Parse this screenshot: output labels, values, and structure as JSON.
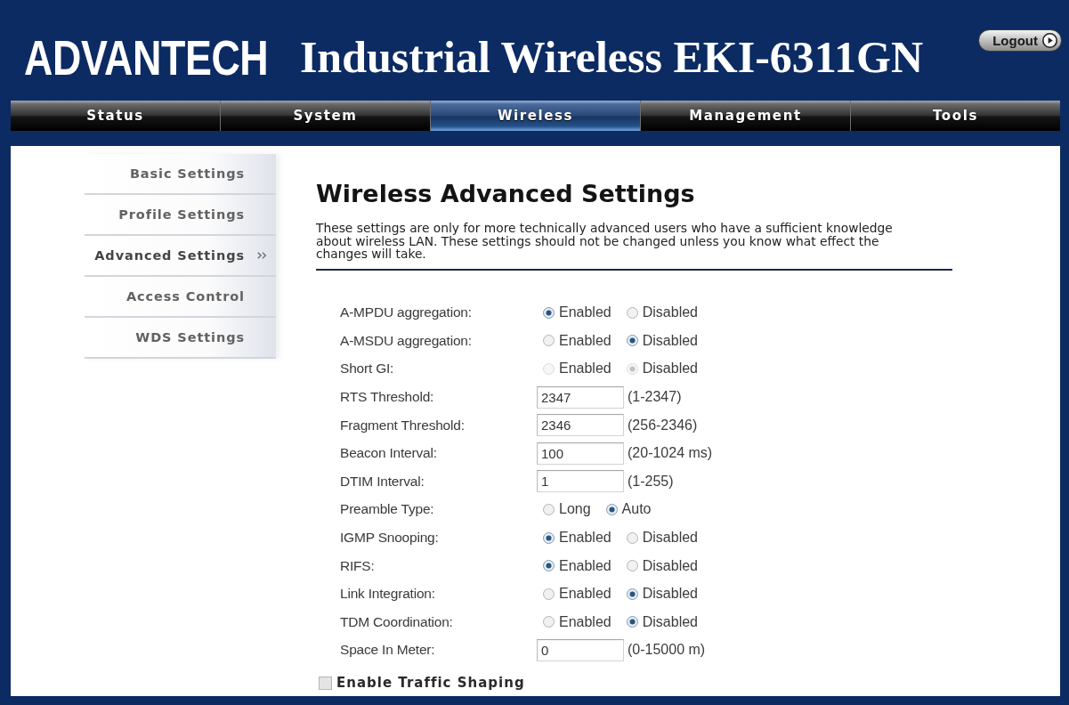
{
  "header": {
    "logo": "ADVANTECH",
    "title": "Industrial Wireless EKI-6311GN",
    "logout_button": "Logout"
  },
  "nav_tabs": [
    {
      "label": "Status",
      "selected": false
    },
    {
      "label": "System",
      "selected": false
    },
    {
      "label": "Wireless",
      "selected": true
    },
    {
      "label": "Management",
      "selected": false
    },
    {
      "label": "Tools",
      "selected": false
    }
  ],
  "sidebar": {
    "items": [
      {
        "label": "Basic Settings",
        "selected": false
      },
      {
        "label": "Profile Settings",
        "selected": false
      },
      {
        "label": "Advanced Settings",
        "selected": true
      },
      {
        "label": "Access Control",
        "selected": false
      },
      {
        "label": "WDS Settings",
        "selected": false
      }
    ]
  },
  "main": {
    "title": "Wireless Advanced Settings",
    "description": "These settings are only for more technically advanced users who have a sufficient knowledge about wireless LAN. These settings should not be changed unless you know what effect the changes will take.",
    "settings": [
      {
        "kind": "radio",
        "label": "A-MPDU aggregation:",
        "disabled": false,
        "options": [
          {
            "label": "Enabled",
            "selected": true
          },
          {
            "label": "Disabled",
            "selected": false
          }
        ]
      },
      {
        "kind": "radio",
        "label": "A-MSDU aggregation:",
        "disabled": false,
        "options": [
          {
            "label": "Enabled",
            "selected": false
          },
          {
            "label": "Disabled",
            "selected": true
          }
        ]
      },
      {
        "kind": "radio",
        "label": "Short GI:",
        "disabled": true,
        "options": [
          {
            "label": "Enabled",
            "selected": false
          },
          {
            "label": "Disabled",
            "selected": true
          }
        ]
      },
      {
        "kind": "input",
        "label": "RTS Threshold:",
        "disabled": false,
        "value": "2347",
        "range": "(1-2347)"
      },
      {
        "kind": "input",
        "label": "Fragment Threshold:",
        "disabled": false,
        "value": "2346",
        "range": "(256-2346)"
      },
      {
        "kind": "input",
        "label": "Beacon Interval:",
        "disabled": false,
        "value": "100",
        "range": "(20-1024 ms)"
      },
      {
        "kind": "input",
        "label": "DTIM Interval:",
        "disabled": false,
        "value": "1",
        "range": "(1-255)"
      },
      {
        "kind": "radio",
        "label": "Preamble Type:",
        "disabled": false,
        "options": [
          {
            "label": "Long",
            "selected": false
          },
          {
            "label": "Auto",
            "selected": true
          }
        ]
      },
      {
        "kind": "radio",
        "label": "IGMP Snooping:",
        "disabled": false,
        "options": [
          {
            "label": "Enabled",
            "selected": true
          },
          {
            "label": "Disabled",
            "selected": false
          }
        ]
      },
      {
        "kind": "radio",
        "label": "RIFS:",
        "disabled": false,
        "options": [
          {
            "label": "Enabled",
            "selected": true
          },
          {
            "label": "Disabled",
            "selected": false
          }
        ]
      },
      {
        "kind": "radio",
        "label": "Link Integration:",
        "disabled": false,
        "options": [
          {
            "label": "Enabled",
            "selected": false
          },
          {
            "label": "Disabled",
            "selected": true
          }
        ]
      },
      {
        "kind": "radio",
        "label": "TDM Coordination:",
        "disabled": false,
        "options": [
          {
            "label": "Enabled",
            "selected": false
          },
          {
            "label": "Disabled",
            "selected": true
          }
        ]
      },
      {
        "kind": "input",
        "label": "Space In Meter:",
        "disabled": false,
        "value": "0",
        "range": "(0-15000 m)"
      }
    ],
    "traffic_shaping": {
      "label": "Enable Traffic Shaping",
      "checked": false
    }
  }
}
